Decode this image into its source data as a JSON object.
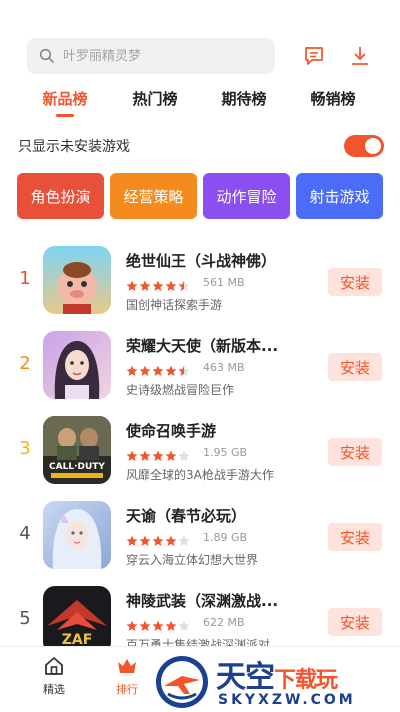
{
  "search": {
    "placeholder": "叶罗丽精灵梦"
  },
  "header": {
    "icons": [
      "message-icon",
      "download-icon"
    ]
  },
  "tabs": [
    {
      "label": "新品榜",
      "active": true
    },
    {
      "label": "热门榜",
      "active": false
    },
    {
      "label": "期待榜",
      "active": false
    },
    {
      "label": "畅销榜",
      "active": false
    }
  ],
  "filter": {
    "label": "只显示未安装游戏",
    "toggle_on": true
  },
  "categories": [
    {
      "label": "角色扮演",
      "color": "#e9503a"
    },
    {
      "label": "经营策略",
      "color": "#f58b1f"
    },
    {
      "label": "动作冒险",
      "color": "#8b4ef0"
    },
    {
      "label": "射击游戏",
      "color": "#4a6cf7"
    }
  ],
  "games": [
    {
      "rank": "1",
      "rank_color": "#e9503a",
      "name": "绝世仙王（斗战神佛）",
      "rating": 4.5,
      "size": "561 MB",
      "desc": "国创神话探索手游",
      "button": "安装"
    },
    {
      "rank": "2",
      "rank_color": "#f58b1f",
      "name": "荣耀大天使（新版本...",
      "rating": 4.5,
      "size": "463 MB",
      "desc": "史诗级燃战冒险巨作",
      "button": "安装"
    },
    {
      "rank": "3",
      "rank_color": "#f3b21a",
      "name": "使命召唤手游",
      "rating": 4.0,
      "size": "1.95 GB",
      "desc": "风靡全球的3A枪战手游大作",
      "button": "安装"
    },
    {
      "rank": "4",
      "rank_color": "#555555",
      "name": "天谕（春节必玩）",
      "rating": 4.0,
      "size": "1.89 GB",
      "desc": "穿云入海立体幻想大世界",
      "button": "安装"
    },
    {
      "rank": "5",
      "rank_color": "#555555",
      "name": "神陵武装（深渊激战...",
      "rating": 4.0,
      "size": "622 MB",
      "desc": "百万勇士集结激战深渊派对",
      "button": "安装"
    }
  ],
  "bottom_nav": [
    {
      "label": "精选",
      "active": false
    },
    {
      "label": "排行",
      "active": true
    }
  ],
  "watermark": {
    "title_main": "天空",
    "title_accent": "下载玩",
    "url": "SKYXZW.COM"
  },
  "colors": {
    "accent": "#f2552c",
    "install_bg": "#fde3dc",
    "star": "#f2552c"
  }
}
